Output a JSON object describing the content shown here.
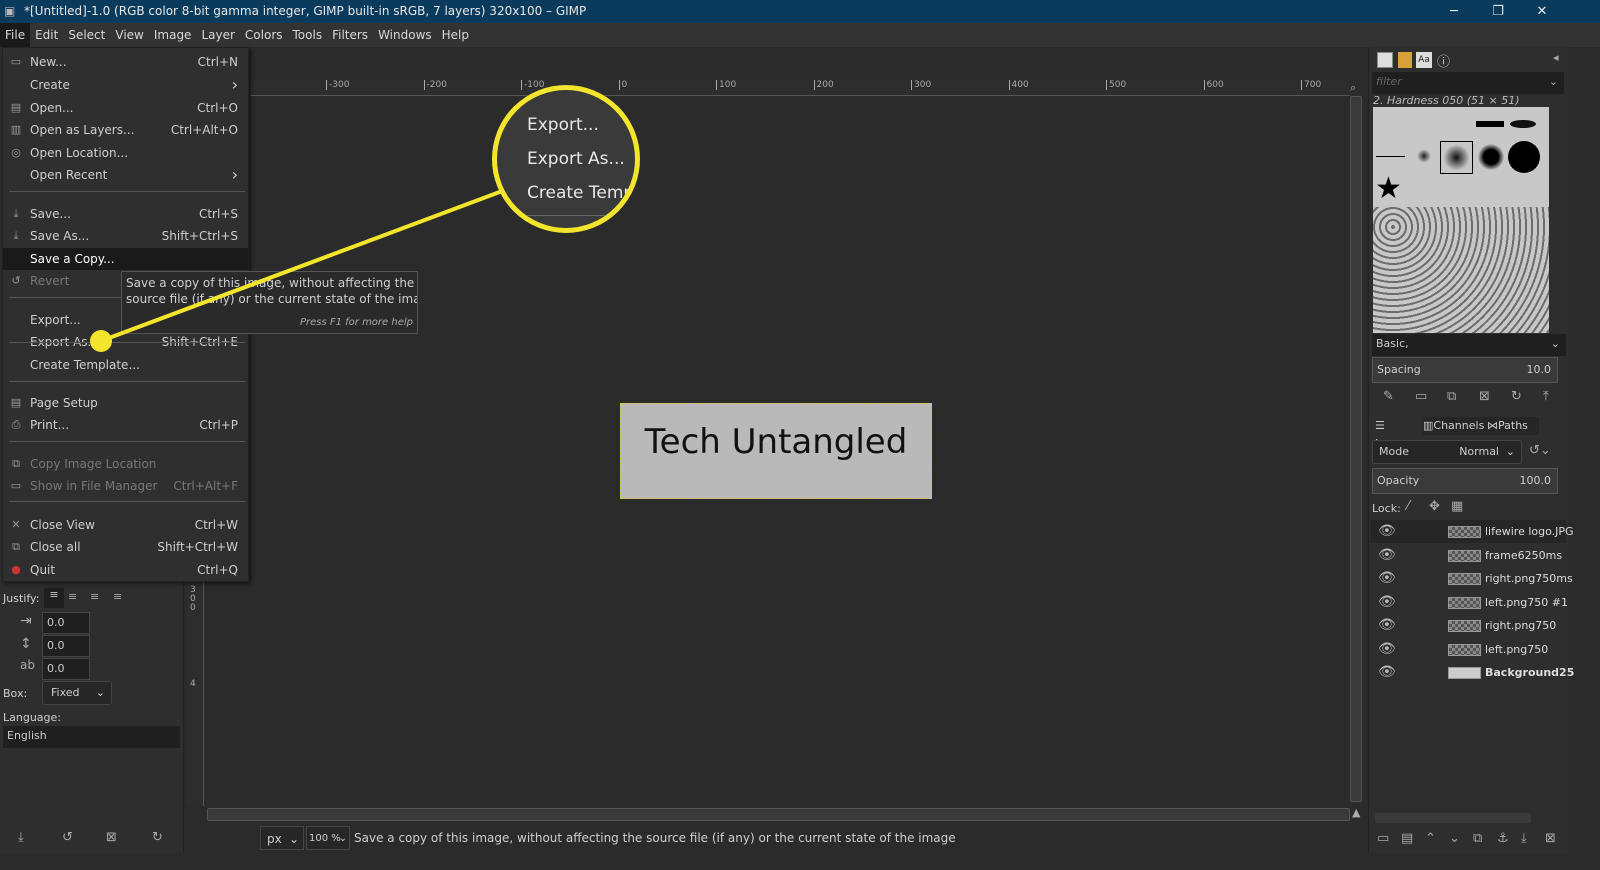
{
  "window": {
    "title": "*[Untitled]-1.0 (RGB color 8-bit gamma integer, GIMP built-in sRGB, 7 layers) 320x100 – GIMP",
    "controls": [
      "minimize",
      "maximize",
      "close"
    ]
  },
  "menubar": [
    "File",
    "Edit",
    "Select",
    "View",
    "Image",
    "Layer",
    "Colors",
    "Tools",
    "Filters",
    "Windows",
    "Help"
  ],
  "file_menu": [
    {
      "label": "New...",
      "shortcut": "Ctrl+N",
      "icon": "new-icon"
    },
    {
      "label": "Create",
      "submenu": true
    },
    {
      "label": "Open...",
      "shortcut": "Ctrl+O",
      "icon": "open-icon"
    },
    {
      "label": "Open as Layers...",
      "shortcut": "Ctrl+Alt+O",
      "icon": "open-layers-icon"
    },
    {
      "label": "Open Location...",
      "icon": "globe-icon"
    },
    {
      "label": "Open Recent",
      "submenu": true
    },
    {
      "label": "Save...",
      "shortcut": "Ctrl+S",
      "icon": "save-icon"
    },
    {
      "label": "Save As...",
      "shortcut": "Shift+Ctrl+S",
      "icon": "save-as-icon"
    },
    {
      "label": "Save a Copy...",
      "highlighted": true
    },
    {
      "label": "Revert",
      "disabled": true,
      "icon": "revert-icon"
    },
    {
      "label": "Export..."
    },
    {
      "label": "Export As...",
      "shortcut": "Shift+Ctrl+E"
    },
    {
      "label": "Create Template..."
    },
    {
      "label": "Page Setup",
      "icon": "page-setup-icon"
    },
    {
      "label": "Print...",
      "shortcut": "Ctrl+P",
      "icon": "print-icon"
    },
    {
      "label": "Copy Image Location",
      "disabled": true,
      "icon": "copy-icon"
    },
    {
      "label": "Show in File Manager",
      "shortcut": "Ctrl+Alt+F",
      "disabled": true,
      "icon": "folder-icon"
    },
    {
      "label": "Close View",
      "shortcut": "Ctrl+W",
      "icon": "close-icon"
    },
    {
      "label": "Close all",
      "shortcut": "Shift+Ctrl+W",
      "icon": "close-all-icon"
    },
    {
      "label": "Quit",
      "shortcut": "Ctrl+Q",
      "icon": "quit-icon"
    }
  ],
  "tooltip": {
    "text1": "Save a copy of this image, without affecting the",
    "text2": "source file (if any) or the current state of the image",
    "hint": "Press F1 for more help"
  },
  "callout": [
    "Export...",
    "Export As...",
    "Create Templ"
  ],
  "callout_color": "#f2e52c",
  "canvas": {
    "text": "Tech Untangled",
    "hruler": [
      "-300",
      "-200",
      "-100",
      "0",
      "100",
      "200",
      "300",
      "400",
      "500",
      "600",
      "700"
    ],
    "vruler": [
      "2\n0\n0",
      "3\n0\n0",
      "4"
    ]
  },
  "tool_options": {
    "justify_label": "Justify:",
    "indent": "0.0",
    "line_spacing": "0.0",
    "letter_spacing": "0.0",
    "box_label": "Box:",
    "box_value": "Fixed",
    "language_label": "Language:",
    "language_value": "English"
  },
  "brushes": {
    "filter_placeholder": "filter",
    "selected": "2. Hardness 050 (51 × 51)",
    "tag": "Basic,",
    "spacing_label": "Spacing",
    "spacing_value": "10.0"
  },
  "layers_panel": {
    "tabs": [
      "Layers",
      "Channels",
      "Paths"
    ],
    "mode_label": "Mode",
    "mode_value": "Normal",
    "opacity_label": "Opacity",
    "opacity_value": "100.0",
    "lock_label": "Lock:",
    "layers": [
      {
        "name": "lifewire logo.JPG",
        "bold": false
      },
      {
        "name": "frame6250ms"
      },
      {
        "name": "right.png750ms"
      },
      {
        "name": "left.png750 #1"
      },
      {
        "name": "right.png750"
      },
      {
        "name": "left.png750"
      },
      {
        "name": "Background25",
        "bold": true
      }
    ]
  },
  "statusbar": {
    "unit": "px",
    "zoom": "100 %",
    "message": "Save a copy of this image, without affecting the source file (if any) or the current state of the image"
  }
}
